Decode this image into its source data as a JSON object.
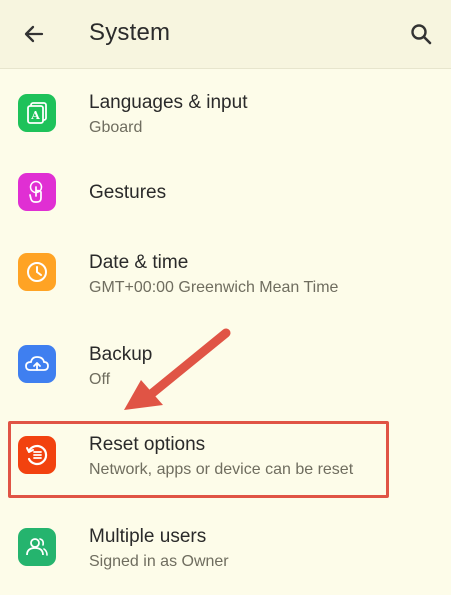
{
  "header": {
    "title": "System"
  },
  "items": [
    {
      "title": "Languages & input",
      "subtitle": "Gboard",
      "icon": "language-icon",
      "color": "#1ec25a"
    },
    {
      "title": "Gestures",
      "subtitle": "",
      "icon": "gesture-icon",
      "color": "#e02fd3"
    },
    {
      "title": "Date & time",
      "subtitle": "GMT+00:00 Greenwich Mean Time",
      "icon": "clock-icon",
      "color": "#ffa324"
    },
    {
      "title": "Backup",
      "subtitle": "Off",
      "icon": "cloud-backup-icon",
      "color": "#3f7ff0"
    },
    {
      "title": "Reset options",
      "subtitle": "Network, apps or device can be reset",
      "icon": "reset-icon",
      "color": "#f2420f"
    },
    {
      "title": "Multiple users",
      "subtitle": "Signed in as Owner",
      "icon": "users-icon",
      "color": "#25b46e"
    }
  ],
  "colors": {
    "annotation": "#e05445",
    "background": "#fdfce9"
  }
}
